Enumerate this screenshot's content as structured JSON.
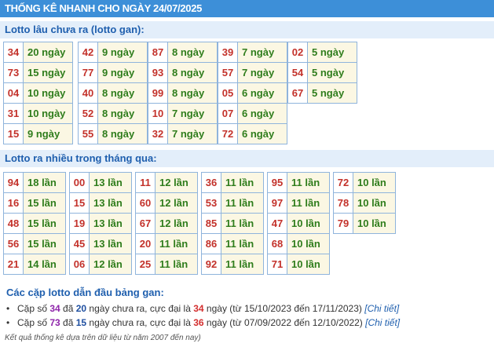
{
  "header": {
    "title": "THỐNG KÊ NHANH CHO NGÀY 24/07/2025"
  },
  "gan": {
    "title": "Lotto lâu chưa ra (lotto gan):",
    "columns": [
      [
        {
          "n": "34",
          "v": "20 ngày"
        },
        {
          "n": "73",
          "v": "15 ngày"
        },
        {
          "n": "04",
          "v": "10 ngày"
        },
        {
          "n": "31",
          "v": "10 ngày"
        },
        {
          "n": "15",
          "v": "9 ngày"
        }
      ],
      [
        {
          "n": "42",
          "v": "9 ngày"
        },
        {
          "n": "77",
          "v": "9 ngày"
        },
        {
          "n": "40",
          "v": "8 ngày"
        },
        {
          "n": "52",
          "v": "8 ngày"
        },
        {
          "n": "55",
          "v": "8 ngày"
        }
      ],
      [
        {
          "n": "87",
          "v": "8 ngày"
        },
        {
          "n": "93",
          "v": "8 ngày"
        },
        {
          "n": "99",
          "v": "8 ngày"
        },
        {
          "n": "10",
          "v": "7 ngày"
        },
        {
          "n": "32",
          "v": "7 ngày"
        }
      ],
      [
        {
          "n": "39",
          "v": "7 ngày"
        },
        {
          "n": "57",
          "v": "7 ngày"
        },
        {
          "n": "05",
          "v": "6 ngày"
        },
        {
          "n": "07",
          "v": "6 ngày"
        },
        {
          "n": "72",
          "v": "6 ngày"
        }
      ],
      [
        {
          "n": "02",
          "v": "5 ngày"
        },
        {
          "n": "54",
          "v": "5 ngày"
        },
        {
          "n": "67",
          "v": "5 ngày"
        }
      ]
    ]
  },
  "frequent": {
    "title": "Lotto ra nhiều trong tháng qua:",
    "columns": [
      [
        {
          "n": "94",
          "v": "18 lần"
        },
        {
          "n": "16",
          "v": "15 lần"
        },
        {
          "n": "48",
          "v": "15 lần"
        },
        {
          "n": "56",
          "v": "15 lần"
        },
        {
          "n": "21",
          "v": "14 lần"
        }
      ],
      [
        {
          "n": "00",
          "v": "13 lần"
        },
        {
          "n": "15",
          "v": "13 lần"
        },
        {
          "n": "19",
          "v": "13 lần"
        },
        {
          "n": "45",
          "v": "13 lần"
        },
        {
          "n": "06",
          "v": "12 lần"
        }
      ],
      [
        {
          "n": "11",
          "v": "12 lần"
        },
        {
          "n": "60",
          "v": "12 lần"
        },
        {
          "n": "67",
          "v": "12 lần"
        },
        {
          "n": "20",
          "v": "11 lần"
        },
        {
          "n": "25",
          "v": "11 lần"
        }
      ],
      [
        {
          "n": "36",
          "v": "11 lần"
        },
        {
          "n": "53",
          "v": "11 lần"
        },
        {
          "n": "85",
          "v": "11 lần"
        },
        {
          "n": "86",
          "v": "11 lần"
        },
        {
          "n": "92",
          "v": "11 lần"
        }
      ],
      [
        {
          "n": "95",
          "v": "11 lần"
        },
        {
          "n": "97",
          "v": "11 lần"
        },
        {
          "n": "47",
          "v": "10 lần"
        },
        {
          "n": "68",
          "v": "10 lần"
        },
        {
          "n": "71",
          "v": "10 lần"
        }
      ],
      [
        {
          "n": "72",
          "v": "10 lần"
        },
        {
          "n": "78",
          "v": "10 lần"
        },
        {
          "n": "79",
          "v": "10 lần"
        }
      ]
    ]
  },
  "pairs": {
    "title": "Các cặp lotto dẫn đầu bảng gan:",
    "items": [
      {
        "t1": "Cặp số ",
        "num": "34",
        "t2": " đã ",
        "days": "20",
        "t3": " ngày chưa ra, cực đại là ",
        "max": "34",
        "t4": " ngày (từ 15/10/2023 đến 17/11/2023) ",
        "link": "[Chi tiết]"
      },
      {
        "t1": "Cặp số ",
        "num": "73",
        "t2": " đã ",
        "days": "15",
        "t3": " ngày chưa ra, cực đại là ",
        "max": "36",
        "t4": " ngày (từ 07/09/2022 đến 12/10/2022) ",
        "link": "[Chi tiết]"
      }
    ]
  },
  "footnote": "Kết quả thống kê dựa trên dữ liệu từ năm 2007 đến nay)"
}
